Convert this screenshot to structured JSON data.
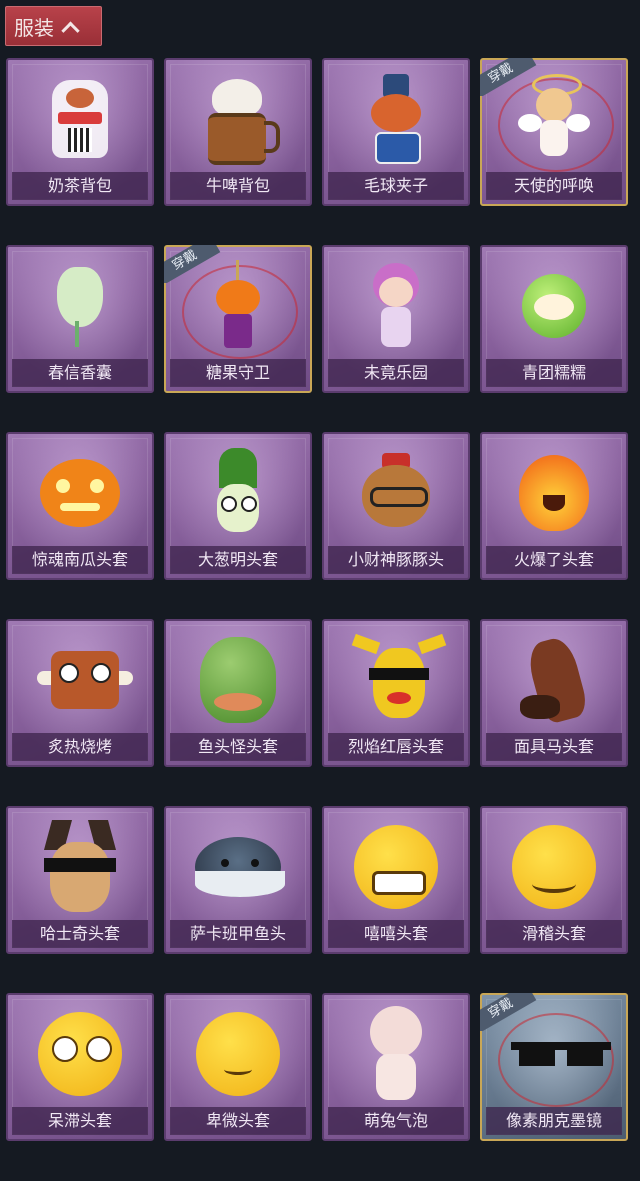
{
  "header": {
    "tab_label": "服装"
  },
  "badge_text": "穿戴",
  "items": [
    {
      "label": "奶茶背包",
      "icon": "milk-tea-backpack-icon",
      "worn": false
    },
    {
      "label": "牛啤背包",
      "icon": "beer-barrel-backpack-icon",
      "worn": false
    },
    {
      "label": "毛球夹子",
      "icon": "raccoon-drummer-clip-icon",
      "worn": false
    },
    {
      "label": "天使的呼唤",
      "icon": "angel-icon",
      "worn": true
    },
    {
      "label": "春信香囊",
      "icon": "sachet-icon",
      "worn": false
    },
    {
      "label": "糖果守卫",
      "icon": "pumpkin-scarecrow-icon",
      "worn": true
    },
    {
      "label": "未竟乐园",
      "icon": "doll-icon",
      "worn": false
    },
    {
      "label": "青团糯糯",
      "icon": "green-rice-ball-icon",
      "worn": false
    },
    {
      "label": "惊魂南瓜头套",
      "icon": "pumpkin-head-icon",
      "worn": false
    },
    {
      "label": "大葱明头套",
      "icon": "scallion-head-icon",
      "worn": false
    },
    {
      "label": "小财神豚豚头",
      "icon": "capybara-head-icon",
      "worn": false
    },
    {
      "label": "火爆了头套",
      "icon": "fire-head-icon",
      "worn": false
    },
    {
      "label": "炙热烧烤",
      "icon": "meat-head-icon",
      "worn": false
    },
    {
      "label": "鱼头怪头套",
      "icon": "fish-head-icon",
      "worn": false
    },
    {
      "label": "烈焰红唇头套",
      "icon": "yellow-mouse-head-icon",
      "worn": false
    },
    {
      "label": "面具马头套",
      "icon": "horse-head-icon",
      "worn": false
    },
    {
      "label": "哈士奇头套",
      "icon": "husky-head-icon",
      "worn": false
    },
    {
      "label": "萨卡班甲鱼头",
      "icon": "fish-creature-head-icon",
      "worn": false
    },
    {
      "label": "嘻嘻头套",
      "icon": "grin-emoji-head-icon",
      "worn": false
    },
    {
      "label": "滑稽头套",
      "icon": "smirk-emoji-head-icon",
      "worn": false
    },
    {
      "label": "呆滞头套",
      "icon": "dazed-emoji-head-icon",
      "worn": false
    },
    {
      "label": "卑微头套",
      "icon": "shy-emoji-head-icon",
      "worn": false
    },
    {
      "label": "萌兔气泡",
      "icon": "bubble-head-icon",
      "worn": false
    },
    {
      "label": "像素朋克墨镜",
      "icon": "pixel-sunglasses-icon",
      "worn": true
    }
  ]
}
